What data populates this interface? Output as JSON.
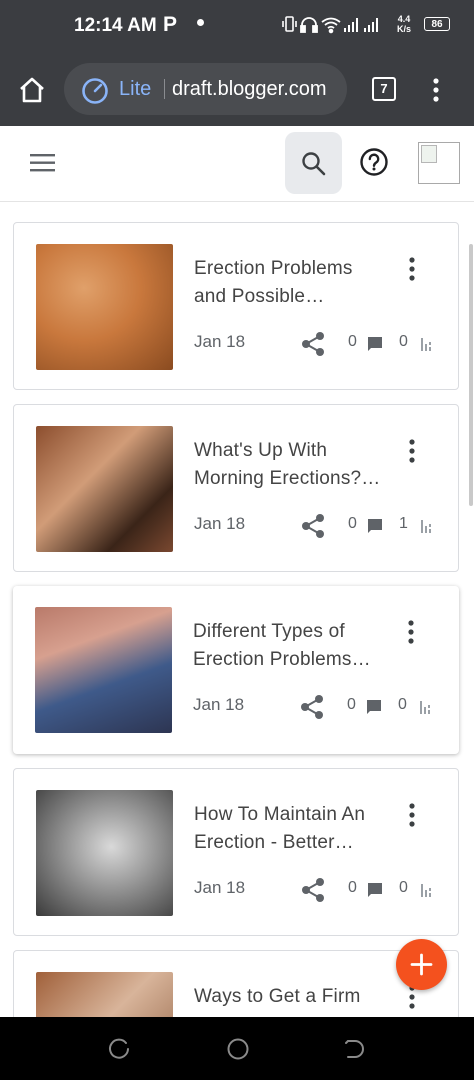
{
  "status_bar": {
    "time": "12:14 AM",
    "app_glyph": "P",
    "net_speed_value": "4.4",
    "net_speed_unit": "K/s",
    "battery": "86",
    "icons": [
      "vibrate-icon",
      "headphones-icon",
      "wifi-icon",
      "signal-icon",
      "signal-icon"
    ]
  },
  "browser": {
    "mode_label": "Lite",
    "url": "draft.blogger.com",
    "tab_count": "7"
  },
  "posts": [
    {
      "title_line1": "Erection Problems",
      "title_line2": "and Possible…",
      "date": "Jan 18",
      "comments": "0",
      "views": "0"
    },
    {
      "title_line1": "What's Up With",
      "title_line2": "Morning Erections?…",
      "date": "Jan 18",
      "comments": "0",
      "views": "1"
    },
    {
      "title_line1": "Different Types of",
      "title_line2": "Erection Problems…",
      "date": "Jan 18",
      "comments": "0",
      "views": "0"
    },
    {
      "title_line1": "How To Maintain An",
      "title_line2": "Erection - Better…",
      "date": "Jan 18",
      "comments": "0",
      "views": "0"
    },
    {
      "title_line1": "Ways to Get a Firm",
      "title_line2": "",
      "date": "",
      "comments": "",
      "views": ""
    }
  ],
  "colors": {
    "chrome": "#3b3d41",
    "accent_blue": "#8ab4f8",
    "fab": "#f4511e",
    "text": "#444444",
    "meta": "#5f6368"
  }
}
